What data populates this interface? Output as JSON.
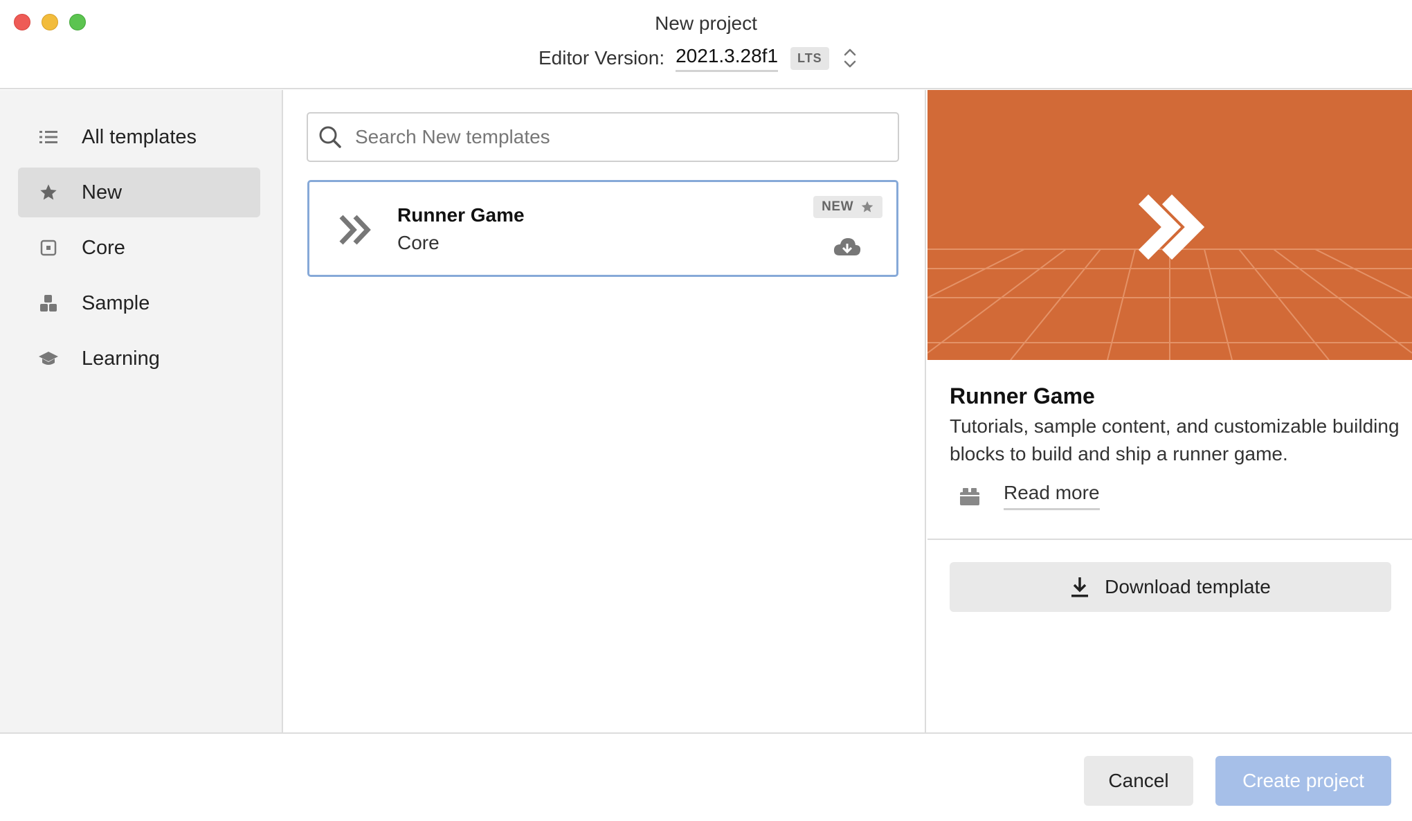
{
  "window": {
    "title": "New project",
    "editor_version_label": "Editor Version:",
    "editor_version_value": "2021.3.28f1",
    "version_badge": "LTS"
  },
  "sidebar": {
    "items": [
      {
        "label": "All templates",
        "icon": "list-icon",
        "active": false
      },
      {
        "label": "New",
        "icon": "star-icon",
        "active": true
      },
      {
        "label": "Core",
        "icon": "core-icon",
        "active": false
      },
      {
        "label": "Sample",
        "icon": "sample-icon",
        "active": false
      },
      {
        "label": "Learning",
        "icon": "graduation-cap-icon",
        "active": false
      }
    ]
  },
  "search": {
    "placeholder": "Search New templates",
    "value": ""
  },
  "templates": [
    {
      "title": "Runner Game",
      "category": "Core",
      "badge": "NEW",
      "icon": "double-chevron-icon",
      "status_icon": "cloud-download-icon",
      "selected": true
    }
  ],
  "detail": {
    "title": "Runner Game",
    "description": "Tutorials, sample content, and customizable building blocks to build and ship a runner game.",
    "read_more_label": "Read more",
    "download_label": "Download template",
    "hero_color": "#d26a37"
  },
  "footer": {
    "cancel_label": "Cancel",
    "create_label": "Create project"
  },
  "colors": {
    "accent_selected_border": "#86a9d8",
    "create_button_disabled": "#a6bfe8",
    "close": "#ee5b56",
    "minimize": "#f2bc3c",
    "maximize": "#5cc450"
  }
}
